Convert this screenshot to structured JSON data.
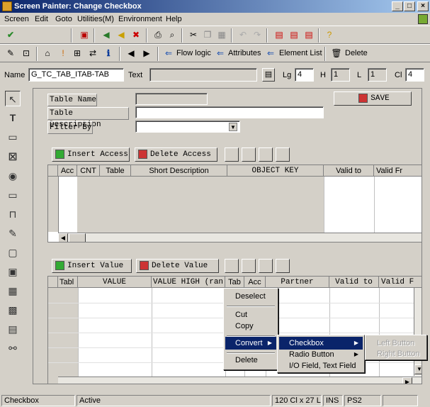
{
  "window": {
    "title": "Screen Painter: Change Checkbox"
  },
  "menubar": [
    "Screen",
    "Edit",
    "Goto",
    "Utilities(M)",
    "Environment",
    "Help"
  ],
  "toolbar2": {
    "flow_logic": "Flow logic",
    "attributes": "Attributes",
    "element_list": "Element List",
    "delete": "Delete"
  },
  "attrs": {
    "name_label": "Name",
    "name_value": "G_TC_TAB_ITAB-TAB",
    "text_label": "Text",
    "text_value": "",
    "lg_label": "Lg",
    "lg_value": "4",
    "h_label": "H",
    "h_value": "1",
    "l_label": "L",
    "l_value": "1",
    "cl_label": "Cl",
    "cl_value": "4"
  },
  "form": {
    "table_name_label": "Table Name",
    "table_description_label": "Table Description",
    "filter_by_label": "Filter By",
    "save_label": "SAVE"
  },
  "table1": {
    "insert_label": "Insert Access",
    "delete_label": "Delete Access",
    "columns": [
      "Acc",
      "CNT",
      "Table",
      "Short Description",
      "OBJECT KEY",
      "Valid to",
      "Valid Fr"
    ]
  },
  "table2": {
    "insert_label": "Insert Value",
    "delete_label": "Delete Value",
    "columns": [
      "Tabl",
      "VALUE",
      "VALUE HIGH (ran",
      "Tab",
      "Acc",
      "Partner",
      "Valid to",
      "Valid F"
    ]
  },
  "context_menu": {
    "deselect": "Deselect",
    "cut": "Cut",
    "copy": "Copy",
    "convert": "Convert",
    "delete": "Delete"
  },
  "convert_submenu": {
    "checkbox": "Checkbox",
    "radio_button": "Radio Button",
    "io_field": "I/O Field, Text Field"
  },
  "checkbox_submenu": {
    "left_button": "Left Button",
    "right_button": "Right Button"
  },
  "statusbar": {
    "element": "Checkbox",
    "mode": "Active",
    "size": "120 Cl x 27 L",
    "ins": "INS",
    "ps": "PS2"
  }
}
